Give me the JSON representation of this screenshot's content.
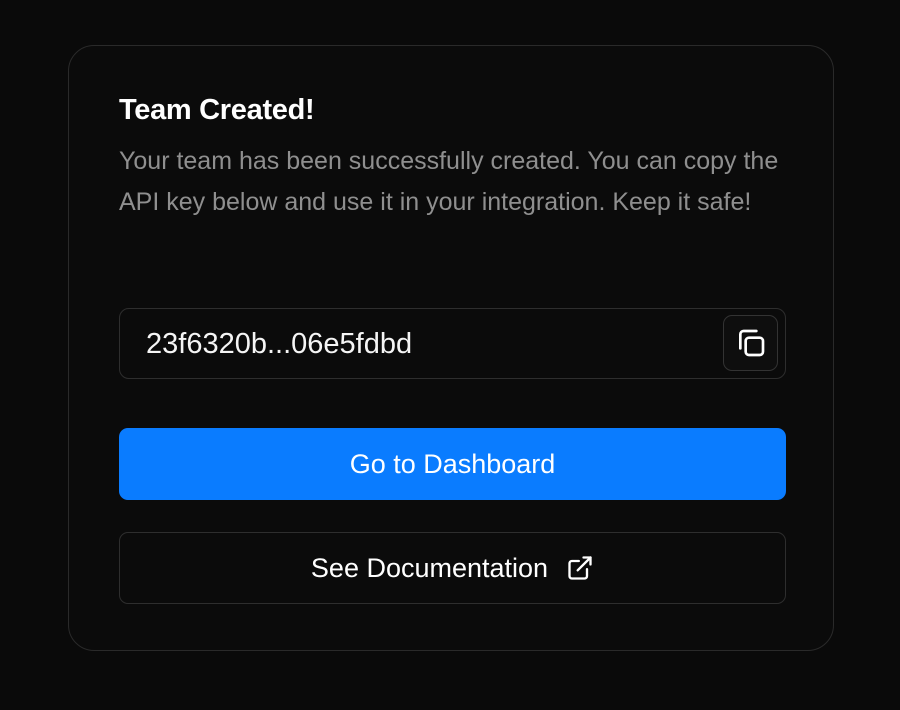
{
  "dialog": {
    "title": "Team Created!",
    "description": "Your team has been successfully created. You can copy the API key below and use it in your integration. Keep it safe!",
    "api_key": "23f6320b...06e5fdbd",
    "copy_icon": "copy-icon",
    "primary_button_label": "Go to Dashboard",
    "secondary_button_label": "See Documentation",
    "external_icon": "external-link-icon"
  },
  "colors": {
    "background": "#0a0a0a",
    "accent": "#0a7cff",
    "title_text": "#ffffff",
    "body_text": "#8f8f8f",
    "border": "#2a2a2a"
  }
}
